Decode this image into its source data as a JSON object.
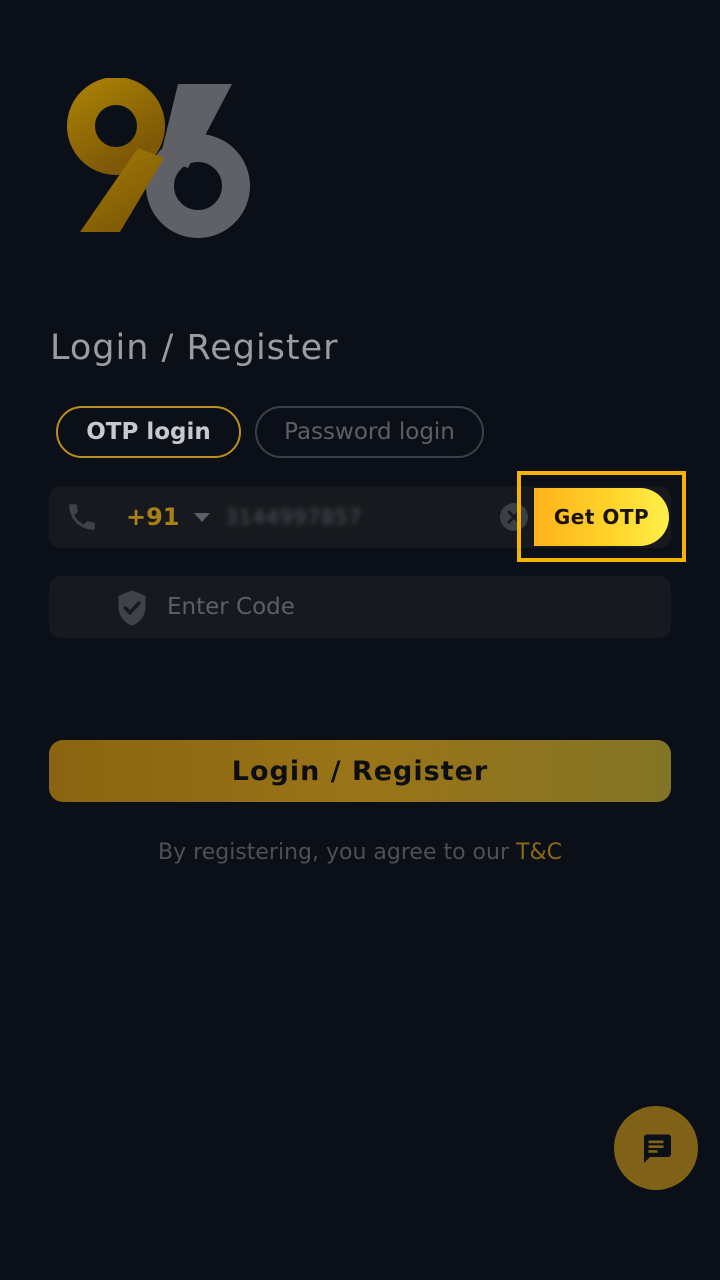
{
  "header": {
    "title": "Login / Register"
  },
  "tabs": [
    {
      "label": "OTP login",
      "active": true
    },
    {
      "label": "Password login",
      "active": false
    }
  ],
  "phone": {
    "country_code": "+91",
    "value": "3144997857",
    "get_otp_label": "Get OTP"
  },
  "code": {
    "placeholder": "Enter Code"
  },
  "actions": {
    "login_label": "Login / Register"
  },
  "terms": {
    "text": "By registering, you agree to our ",
    "link": "T&C"
  },
  "colors": {
    "accent": "#f4b400",
    "gold": "#a88018",
    "background": "#0b0f17"
  },
  "icons": {
    "phone": "phone-icon",
    "shield": "shield-check-icon",
    "clear": "clear-icon",
    "chat": "chat-icon"
  }
}
